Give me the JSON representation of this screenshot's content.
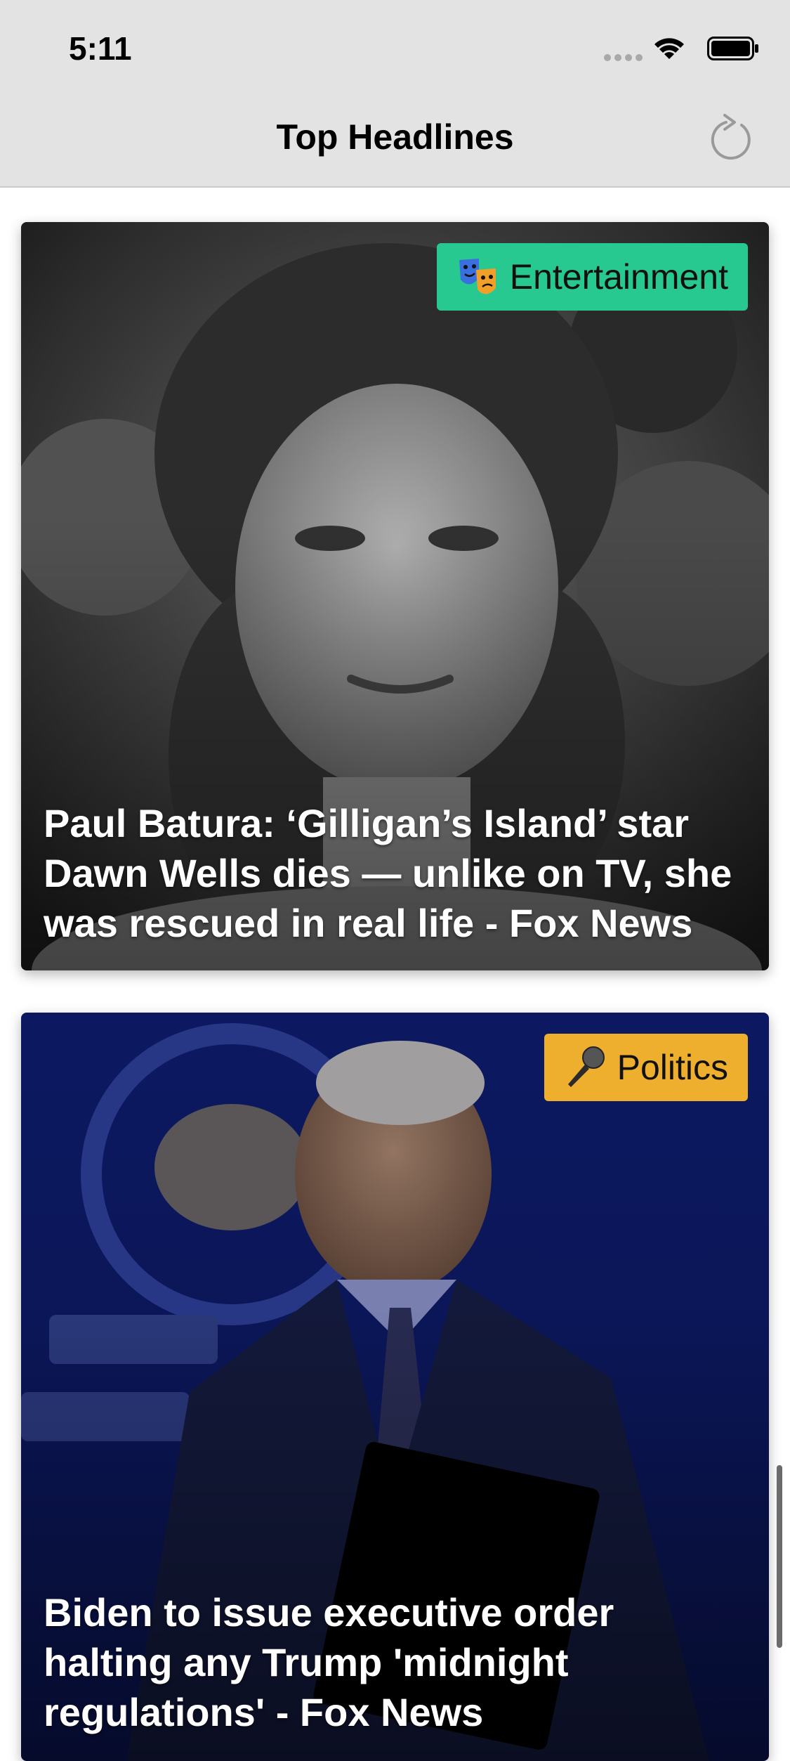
{
  "status": {
    "time": "5:11"
  },
  "nav": {
    "title": "Top Headlines",
    "refresh_icon": "refresh-icon"
  },
  "articles": [
    {
      "category": "Entertainment",
      "category_icon": "performing-arts-masks-icon",
      "category_color": "#27c990",
      "headline": "Paul Batura: ‘Gilligan’s Island’ star Dawn Wells dies — unlike on TV, she was rescued in real life - Fox News"
    },
    {
      "category": "Politics",
      "category_icon": "microphone-icon",
      "category_color": "#eeae2e",
      "headline": "Biden to issue executive order halting any Trump 'midnight regulations' - Fox News"
    }
  ],
  "colors": {
    "nav_background": "#e3e3e3",
    "entertainment": "#27c990",
    "politics": "#eeae2e"
  }
}
